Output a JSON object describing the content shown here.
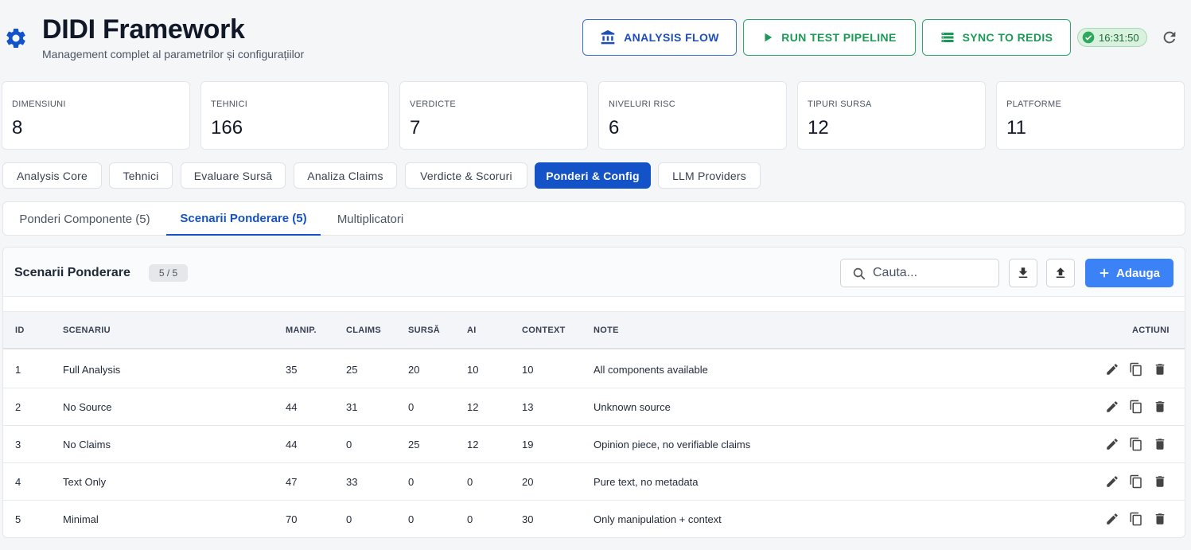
{
  "header": {
    "title": "DIDI Framework",
    "subtitle": "Management complet al parametrilor și configurațiilor",
    "buttons": {
      "analysis_flow": "ANALYSIS FLOW",
      "run_test_pipeline": "RUN TEST PIPELINE",
      "sync_to_redis": "SYNC TO REDIS"
    },
    "status_time": "16:31:50"
  },
  "stats": [
    {
      "label": "DIMENSIUNI",
      "value": "8"
    },
    {
      "label": "TEHNICI",
      "value": "166"
    },
    {
      "label": "VERDICTE",
      "value": "7"
    },
    {
      "label": "NIVELURI RISC",
      "value": "6"
    },
    {
      "label": "TIPURI SURSA",
      "value": "12"
    },
    {
      "label": "PLATFORME",
      "value": "11"
    }
  ],
  "main_tabs": [
    {
      "label": "Analysis Core"
    },
    {
      "label": "Tehnici"
    },
    {
      "label": "Evaluare Sursă"
    },
    {
      "label": "Analiza Claims"
    },
    {
      "label": "Verdicte & Scoruri"
    },
    {
      "label": "Ponderi & Config"
    },
    {
      "label": "LLM Providers"
    }
  ],
  "sub_tabs": [
    {
      "label": "Ponderi Componente (5)"
    },
    {
      "label": "Scenarii Ponderare (5)"
    },
    {
      "label": "Multiplicatori"
    }
  ],
  "panel": {
    "title": "Scenarii Ponderare",
    "count": "5 / 5",
    "search_placeholder": "Cauta...",
    "add_label": "Adauga"
  },
  "table": {
    "headers": [
      "ID",
      "SCENARIU",
      "MANIP.",
      "CLAIMS",
      "SURSĂ",
      "AI",
      "CONTEXT",
      "NOTE",
      "ACTIUNI"
    ],
    "rows": [
      [
        "1",
        "Full Analysis",
        "35",
        "25",
        "20",
        "10",
        "10",
        "All components available"
      ],
      [
        "2",
        "No Source",
        "44",
        "31",
        "0",
        "12",
        "13",
        "Unknown source"
      ],
      [
        "3",
        "No Claims",
        "44",
        "0",
        "25",
        "12",
        "19",
        "Opinion piece, no verifiable claims"
      ],
      [
        "4",
        "Text Only",
        "47",
        "33",
        "0",
        "0",
        "20",
        "Pure text, no metadata"
      ],
      [
        "5",
        "Minimal",
        "70",
        "0",
        "0",
        "0",
        "30",
        "Only manipulation + context"
      ]
    ]
  },
  "colors": {
    "primary": "#1452c8",
    "add_button": "#3b82f6",
    "success": "#1b9a57"
  }
}
